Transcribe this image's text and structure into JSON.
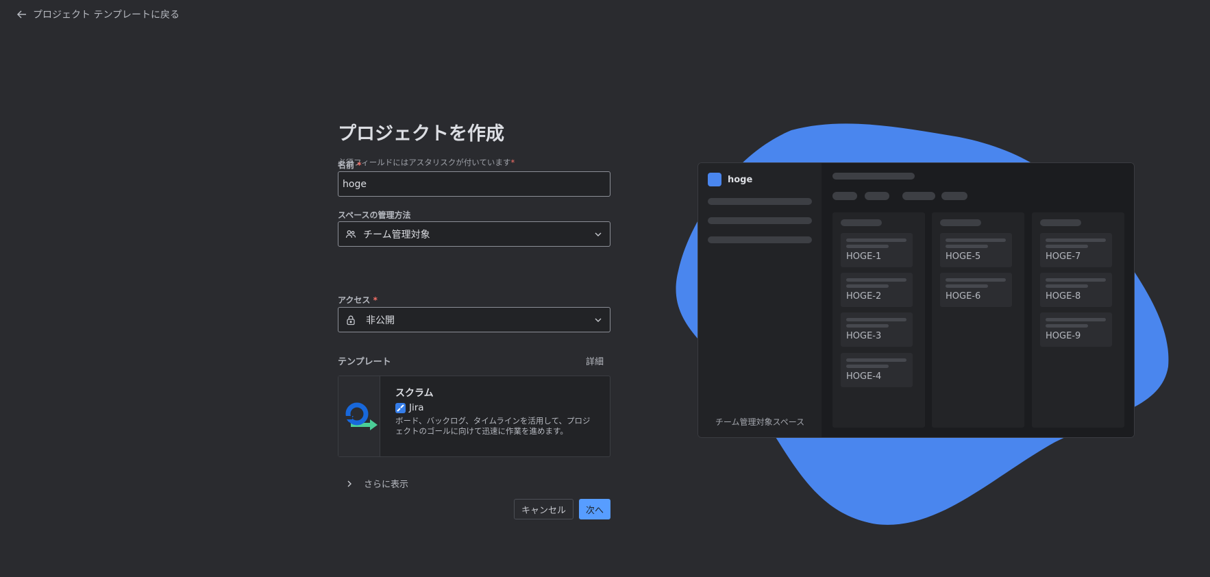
{
  "back_link": {
    "label": "プロジェクト テンプレートに戻る"
  },
  "form": {
    "title": "プロジェクトを作成",
    "required_note": "必須フィールドにはアスタリスクが付いています",
    "required_mark": "*",
    "name": {
      "label": "名前",
      "value": "hoge"
    },
    "space_management": {
      "label": "スペースの管理方法",
      "value": "チーム管理対象",
      "icon": "people-icon"
    },
    "access": {
      "label": "アクセス",
      "value": "非公開",
      "icon": "lock-icon"
    },
    "template": {
      "heading": "テンプレート",
      "details_link": "詳細",
      "card": {
        "title": "スクラム",
        "product": "Jira",
        "description": "ボード、バックログ、タイムラインを活用して、プロジェクトのゴールに向けて迅速に作業を進めます。"
      }
    },
    "show_more": "さらに表示",
    "cancel_button": "キャンセル",
    "next_button": "次へ"
  },
  "preview": {
    "project_name": "hoge",
    "space_label": "チーム管理対象スペース",
    "columns": [
      [
        "HOGE-1",
        "HOGE-2",
        "HOGE-3",
        "HOGE-4"
      ],
      [
        "HOGE-5",
        "HOGE-6"
      ],
      [
        "HOGE-7",
        "HOGE-8",
        "HOGE-9"
      ]
    ]
  },
  "colors": {
    "accent": "#579dff",
    "blob": "#4a86ee",
    "background": "#2a2b2f",
    "required": "#f87168"
  }
}
